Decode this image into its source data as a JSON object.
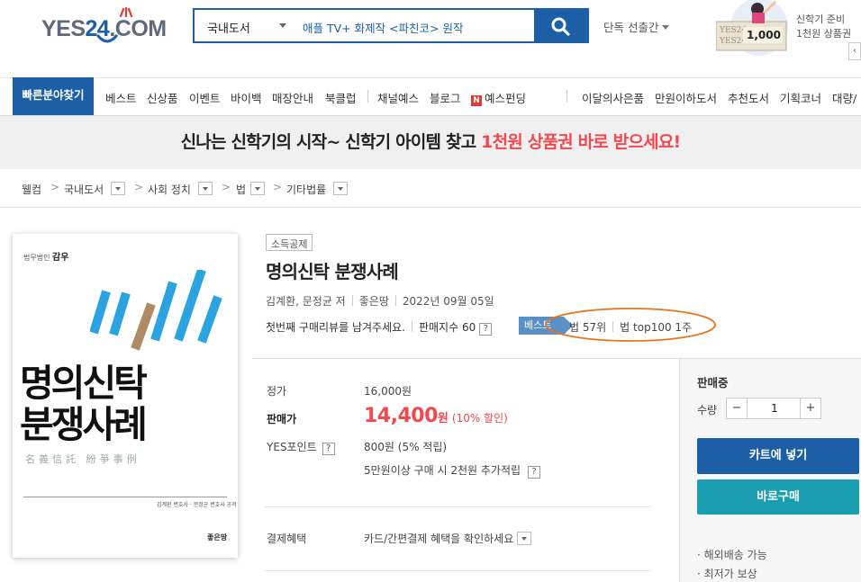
{
  "header": {
    "logo": {
      "prefix": "YES",
      "num": "24",
      "suffix": ".COM"
    },
    "search": {
      "category": "국내도서",
      "query": "애플 TV+ 화제작 <파친코> 원작",
      "button_icon": "search-icon"
    },
    "exclusive_label": "단독 선출간",
    "promo": {
      "line1": "신학기 준비",
      "line2": "1천원 상품권",
      "voucher_amount": "1,000",
      "next_icon": "chevron-left-icon"
    }
  },
  "nav": {
    "quick_label": "빠른분야찾기",
    "left_items": [
      "베스트",
      "신상품",
      "이벤트",
      "바이백",
      "매장안내",
      "북클럽",
      "채널예스",
      "블로그",
      "예스펀딩"
    ],
    "right_items": [
      "이달의사은품",
      "만원이하도서",
      "추천도서",
      "기획코너",
      "대량/"
    ],
    "funding_badge": "N"
  },
  "banner": {
    "text_main": "신나는 신학기의 시작~ 신학기 아이템 찾고 ",
    "text_highlight": "1천원 상품권 바로 받으세요!",
    "highlight_color": "#f0494f"
  },
  "breadcrumb": [
    "웰컴",
    "국내도서",
    "사회 정치",
    "법",
    "기타법률"
  ],
  "cover": {
    "publisher_small": "법무법인",
    "publisher_name": "감우",
    "title_line1": "명의신탁",
    "title_line2": "분쟁사례",
    "subtitle": "名義信託 紛爭事例",
    "authors": "김계환 변호사 · 문정균 변호사 공저",
    "imprint": "좋은땅"
  },
  "product": {
    "tag": "소득공제",
    "title": "명의신탁 분쟁사례",
    "author": "김계환, 문정균 저",
    "publisher": "좋은땅",
    "date": "2022년 09월 05일",
    "review_prompt": "첫번째 구매리뷰를 남겨주세요.",
    "sales_index": "판매지수 60",
    "best_badge": "베스트",
    "rank_1": "법 57위",
    "rank_2": "법 top100 1주"
  },
  "price": {
    "list_label": "정가",
    "list_value": "16,000원",
    "sale_label": "판매가",
    "sale_value": "14,400",
    "sale_unit": "원",
    "discount": "(10% 할인)",
    "points_label": "YES포인트",
    "points_value": "800원 (5% 적립)",
    "extra_points": "5만원이상 구매 시 2천원 추가적립",
    "payment_label": "결제혜택",
    "payment_value": "카드/간편결제 혜택을 확인하세요"
  },
  "buy": {
    "status": "판매중",
    "qty_label": "수량",
    "qty_value": "1",
    "minus": "−",
    "plus": "+",
    "cart_label": "카트에 넣기",
    "buy_label": "바로구매",
    "services": [
      "· 해외배송 가능",
      "· 최저가 보상"
    ]
  },
  "colors": {
    "brand_blue": "#1c5fa6",
    "teal": "#1a9eb2",
    "badge_blue": "#5b8fc7",
    "annotation_orange": "#e8731a"
  }
}
